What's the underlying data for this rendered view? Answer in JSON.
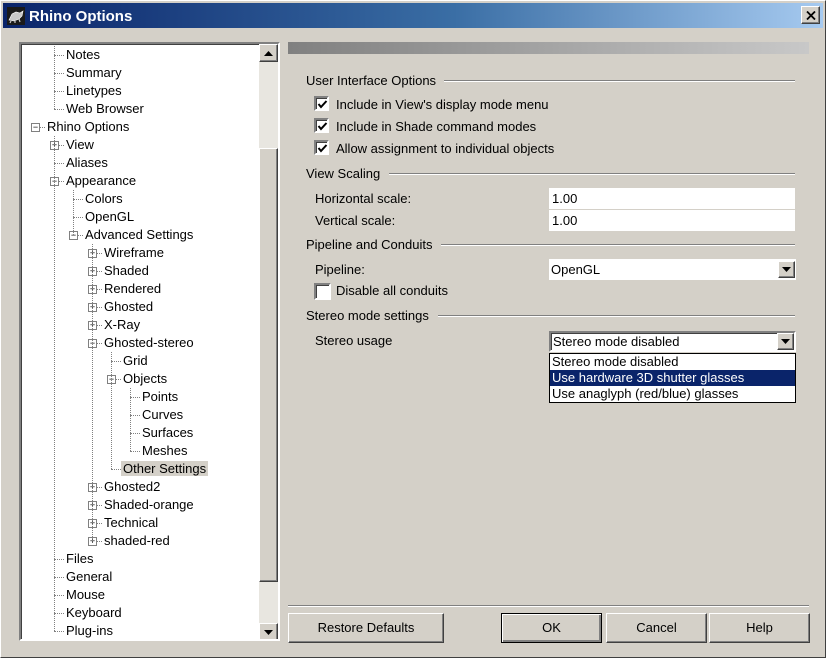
{
  "window": {
    "title": "Rhino Options",
    "close_glyph": "✕"
  },
  "tree": {
    "items": [
      {
        "label": "Notes",
        "level": 1,
        "expander": "",
        "selected": false
      },
      {
        "label": "Summary",
        "level": 1,
        "expander": "",
        "selected": false
      },
      {
        "label": "Linetypes",
        "level": 1,
        "expander": "",
        "selected": false
      },
      {
        "label": "Web Browser",
        "level": 1,
        "expander": "",
        "selected": false
      },
      {
        "label": "Rhino Options",
        "level": 0,
        "expander": "-",
        "selected": false
      },
      {
        "label": "View",
        "level": 1,
        "expander": "+",
        "selected": false
      },
      {
        "label": "Aliases",
        "level": 1,
        "expander": "",
        "selected": false
      },
      {
        "label": "Appearance",
        "level": 1,
        "expander": "-",
        "selected": false
      },
      {
        "label": "Colors",
        "level": 2,
        "expander": "",
        "selected": false
      },
      {
        "label": "OpenGL",
        "level": 2,
        "expander": "",
        "selected": false
      },
      {
        "label": "Advanced Settings",
        "level": 2,
        "expander": "-",
        "selected": false
      },
      {
        "label": "Wireframe",
        "level": 3,
        "expander": "+",
        "selected": false
      },
      {
        "label": "Shaded",
        "level": 3,
        "expander": "+",
        "selected": false
      },
      {
        "label": "Rendered",
        "level": 3,
        "expander": "+",
        "selected": false
      },
      {
        "label": "Ghosted",
        "level": 3,
        "expander": "+",
        "selected": false
      },
      {
        "label": "X-Ray",
        "level": 3,
        "expander": "+",
        "selected": false
      },
      {
        "label": "Ghosted-stereo",
        "level": 3,
        "expander": "-",
        "selected": false
      },
      {
        "label": "Grid",
        "level": 4,
        "expander": "",
        "selected": false
      },
      {
        "label": "Objects",
        "level": 4,
        "expander": "-",
        "selected": false
      },
      {
        "label": "Points",
        "level": 5,
        "expander": "",
        "selected": false
      },
      {
        "label": "Curves",
        "level": 5,
        "expander": "",
        "selected": false
      },
      {
        "label": "Surfaces",
        "level": 5,
        "expander": "",
        "selected": false
      },
      {
        "label": "Meshes",
        "level": 5,
        "expander": "",
        "selected": false
      },
      {
        "label": "Other Settings",
        "level": 4,
        "expander": "",
        "selected": true
      },
      {
        "label": "Ghosted2",
        "level": 3,
        "expander": "+",
        "selected": false
      },
      {
        "label": "Shaded-orange",
        "level": 3,
        "expander": "+",
        "selected": false
      },
      {
        "label": "Technical",
        "level": 3,
        "expander": "+",
        "selected": false
      },
      {
        "label": "shaded-red",
        "level": 3,
        "expander": "+",
        "selected": false
      },
      {
        "label": "Files",
        "level": 1,
        "expander": "",
        "selected": false
      },
      {
        "label": "General",
        "level": 1,
        "expander": "",
        "selected": false
      },
      {
        "label": "Mouse",
        "level": 1,
        "expander": "",
        "selected": false
      },
      {
        "label": "Keyboard",
        "level": 1,
        "expander": "",
        "selected": false
      },
      {
        "label": "Plug-ins",
        "level": 1,
        "expander": "",
        "selected": false
      }
    ]
  },
  "ui_options": {
    "title": "User Interface Options",
    "checks": [
      {
        "label": "Include in View's display mode menu",
        "checked": true
      },
      {
        "label": "Include in Shade command modes",
        "checked": true
      },
      {
        "label": "Allow assignment to individual objects",
        "checked": true
      }
    ]
  },
  "view_scaling": {
    "title": "View Scaling",
    "horizontal_label": "Horizontal scale:",
    "horizontal_value": "1.00",
    "vertical_label": "Vertical scale:",
    "vertical_value": "1.00"
  },
  "pipeline": {
    "title": "Pipeline and Conduits",
    "pipeline_label": "Pipeline:",
    "pipeline_value": "OpenGL",
    "disable_label": "Disable all conduits",
    "disable_checked": false
  },
  "stereo": {
    "title": "Stereo mode settings",
    "usage_label": "Stereo usage",
    "usage_value": "Stereo mode disabled",
    "options": [
      "Stereo mode disabled",
      "Use hardware 3D shutter glasses",
      "Use anaglyph (red/blue) glasses"
    ],
    "highlighted_index": 1
  },
  "buttons": {
    "restore": "Restore Defaults",
    "ok": "OK",
    "cancel": "Cancel",
    "help": "Help"
  },
  "colors": {
    "titlebar_start": "#0a246a",
    "face": "#d4d0c8",
    "highlight": "#0a246a"
  }
}
